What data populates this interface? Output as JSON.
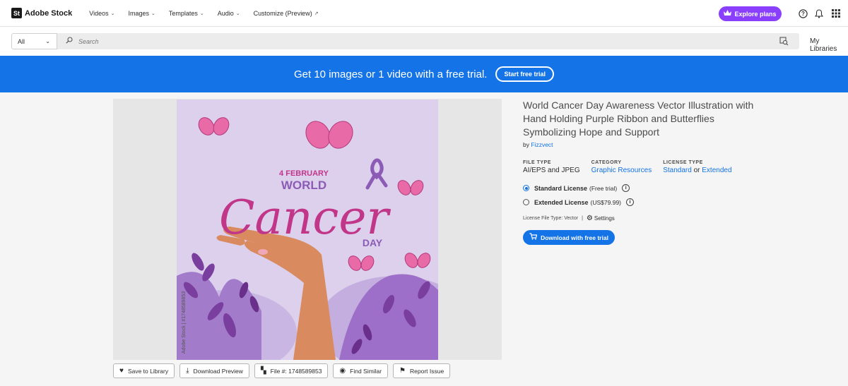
{
  "app": {
    "logo_badge": "St",
    "logo_name": "Adobe Stock"
  },
  "nav": {
    "items": [
      {
        "label": "Videos",
        "chevron": "⌄"
      },
      {
        "label": "Images",
        "chevron": "⌄"
      },
      {
        "label": "Templates",
        "chevron": "⌄"
      },
      {
        "label": "Audio",
        "chevron": "⌄"
      },
      {
        "label": "Customize (Preview)",
        "chevron": "↗"
      }
    ],
    "explore_label": "Explore plans",
    "icons": [
      "help-icon",
      "bell-icon",
      "apps-grid-icon"
    ]
  },
  "search": {
    "scope": "All",
    "placeholder": "Search",
    "my_libraries": "My Libraries"
  },
  "banner": {
    "text": "Get 10 images or 1 video with a free trial.",
    "cta": "Start free trial"
  },
  "artwork": {
    "date_line": "4 FEBRUARY",
    "world": "WORLD",
    "cancer": "Cancer",
    "day": "DAY",
    "side_credit": "Adobe Stock | #1748589853"
  },
  "actions": [
    {
      "icon": "♥",
      "label": "Save to Library"
    },
    {
      "icon": "⤓",
      "label": "Download Preview"
    },
    {
      "icon": "▚",
      "label": "File #: 1748589853"
    },
    {
      "icon": "◉",
      "label": "Find Similar"
    },
    {
      "icon": "⚑",
      "label": "Report Issue"
    }
  ],
  "asset": {
    "title": "World Cancer Day Awareness Vector Illustration with Hand Holding Purple Ribbon and Butterflies Symbolizing Hope and Support",
    "by_prefix": "by",
    "author": "Fizzvect",
    "file_type_label": "FILE TYPE",
    "file_type": "AI/EPS and JPEG",
    "category_label": "CATEGORY",
    "category": "Graphic Resources",
    "license_type_label": "LICENSE TYPE",
    "license_standard": "Standard",
    "license_or": "or",
    "license_extended": "Extended",
    "standard_license": "Standard License",
    "standard_price": "(Free trial)",
    "extended_license": "Extended License",
    "extended_price": "(US$79.99)",
    "license_file_type": "License File Type: Vector",
    "separator": "|",
    "settings": "Settings",
    "download_label": "Download with free trial"
  },
  "colors": {
    "accent": "#1473e6",
    "explore": "#8a3ffc",
    "art_bg": "#dcd0ec",
    "magenta": "#c2368a",
    "purple": "#8c5bb5"
  }
}
